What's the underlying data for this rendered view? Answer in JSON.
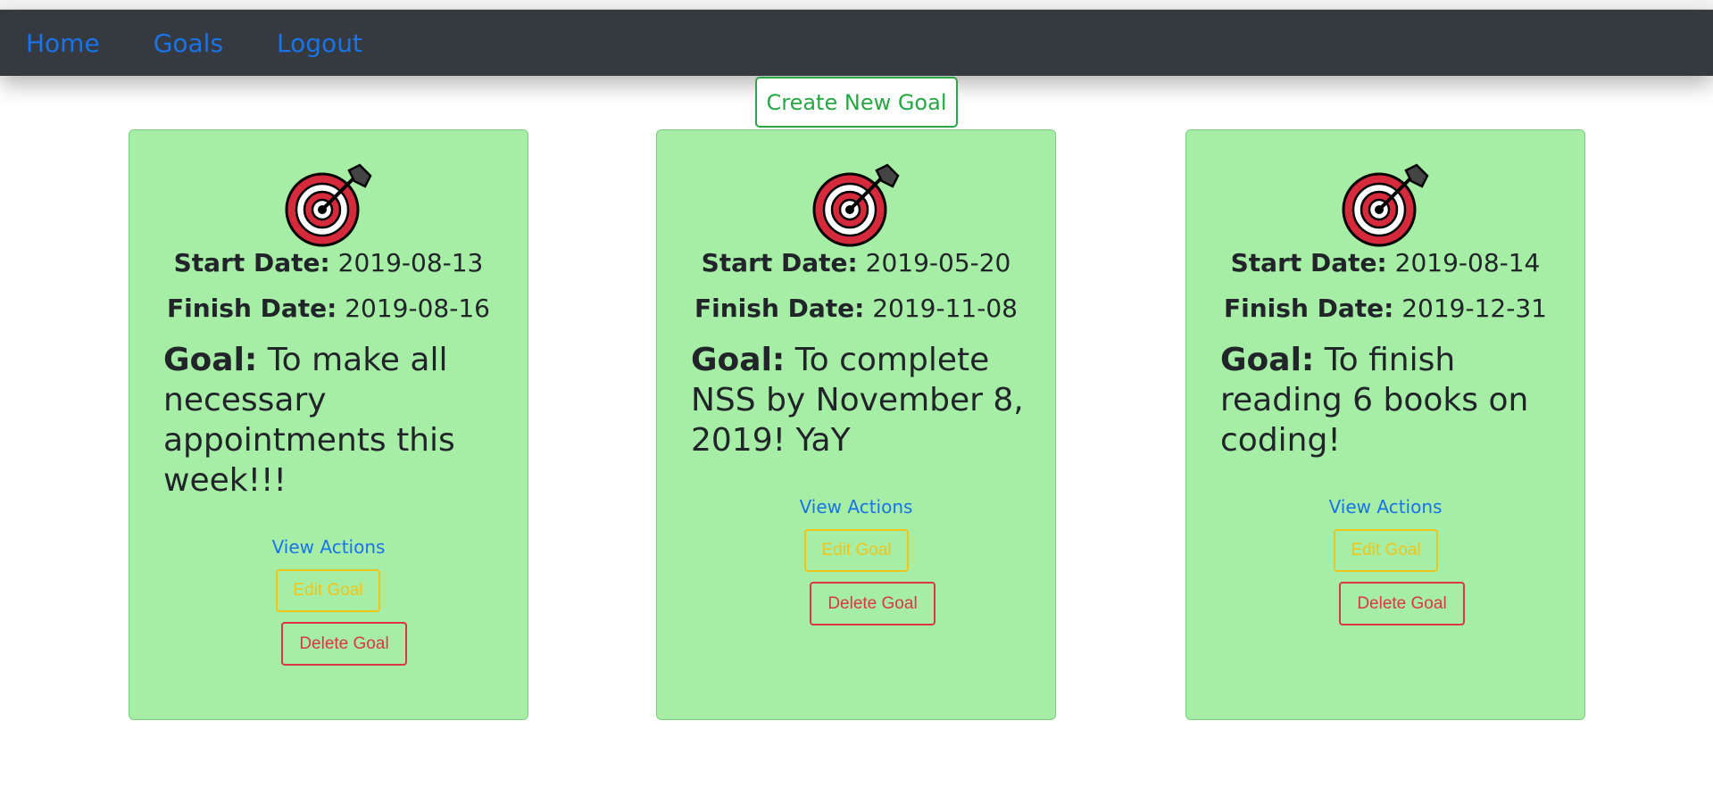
{
  "nav": {
    "links": [
      "Home",
      "Goals",
      "Logout"
    ]
  },
  "create_button_label": "Create New Goal",
  "labels": {
    "start": "Start Date:",
    "finish": "Finish Date:",
    "goal": "Goal:",
    "view_actions": "View Actions",
    "edit": "Edit Goal",
    "delete": "Delete Goal"
  },
  "goals": [
    {
      "start_date": "2019-08-13",
      "finish_date": "2019-08-16",
      "text": "To make all necessary appointments this week!!!"
    },
    {
      "start_date": "2019-05-20",
      "finish_date": "2019-11-08",
      "text": "To complete NSS by November 8, 2019! YaY"
    },
    {
      "start_date": "2019-08-14",
      "finish_date": "2019-12-31",
      "text": "To finish reading 6 books on coding!"
    }
  ],
  "colors": {
    "navbar": "#343a40",
    "link": "#1a73e8",
    "card_bg": "#a6eea6",
    "success": "#28a745",
    "warning": "#f0c419",
    "danger": "#dc3545"
  },
  "icons": {
    "goal_icon": "target-icon"
  }
}
